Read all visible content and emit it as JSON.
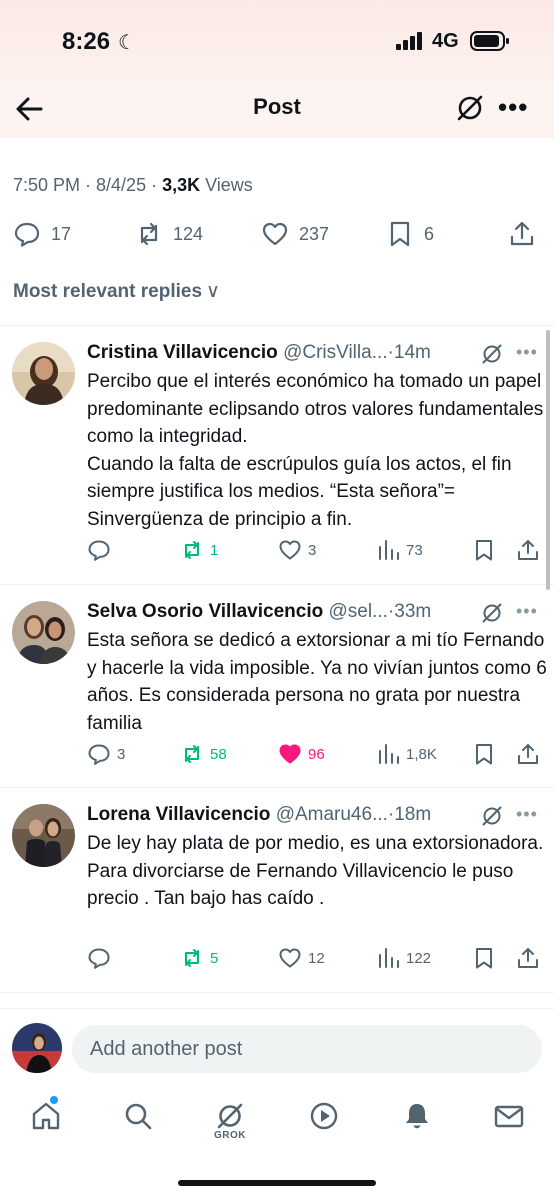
{
  "status": {
    "time": "8:26",
    "network": "4G"
  },
  "header": {
    "title": "Post"
  },
  "post_meta": {
    "time": "7:50 PM · 8/4/25 · ",
    "views_count": "3,3K",
    "views_label": " Views"
  },
  "post_actions": {
    "replies": "17",
    "reposts": "124",
    "likes": "237",
    "bookmarks": "6"
  },
  "replies_filter": {
    "label": "Most relevant replies",
    "chevron": "∨"
  },
  "replies": [
    {
      "name": "Cristina Villavicencio",
      "handle": "@CrisVilla...",
      "time": "·14m",
      "lines": [
        "Percibo  que el interés económico ha tomado un papel predominante eclipsando otros valores fundamentales como la integridad.",
        "Cuando la falta de escrúpulos guía los actos, el fin siempre justifica los medios. “Esta señora”= Sinvergüenza de principio a fin."
      ],
      "reply_count": "",
      "repost_count": "1",
      "like_count": "3",
      "view_count": "73"
    },
    {
      "name": "Selva Osorio Villavicencio",
      "handle": "@sel...",
      "time": "·33m",
      "lines": [
        "Esta señora se dedicó a extorsionar a mi tío Fernando y hacerle la vida imposible. Ya no vivían juntos como 6 años. Es considerada persona no grata por nuestra familia"
      ],
      "reply_count": "3",
      "repost_count": "58",
      "like_count": "96",
      "view_count": "1,8K"
    },
    {
      "name": "Lorena Villavicencio",
      "handle": "@Amaru46...",
      "time": "·18m",
      "lines": [
        "De ley hay plata de por medio, es una extorsionadora. Para divorciarse de Fernando Villavicencio le puso precio . Tan bajo has caído ."
      ],
      "reply_count": "",
      "repost_count": "5",
      "like_count": "12",
      "view_count": "122"
    }
  ],
  "composer": {
    "placeholder": "Add another post"
  },
  "nav": {
    "grok_label": "GROK"
  },
  "colors": {
    "repost_green": "#00ba7c",
    "like_pink": "#f91880",
    "secondary_text": "#536471",
    "accent_blue": "#1d9bf0"
  }
}
